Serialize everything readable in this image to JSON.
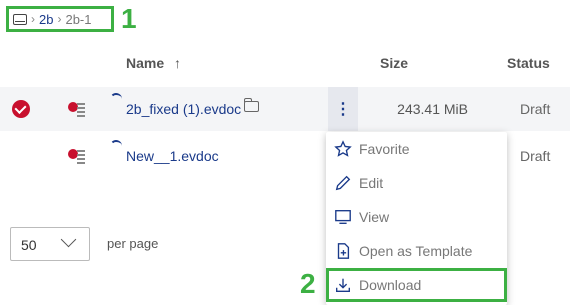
{
  "breadcrumb": {
    "items": [
      "2b",
      "2b-1"
    ]
  },
  "callouts": {
    "one": "1",
    "two": "2"
  },
  "table": {
    "headers": {
      "name": "Name",
      "sort_arrow": "↑",
      "size": "Size",
      "status": "Status"
    },
    "rows": [
      {
        "name": "2b_fixed (1).evdoc",
        "size": "243.41 MiB",
        "status": "Draft",
        "selected": true,
        "actions": "⋮"
      },
      {
        "name": "New__1.evdoc",
        "size": "",
        "status": "Draft",
        "selected": false
      }
    ]
  },
  "pagination": {
    "per_page_value": "50",
    "per_page_label": "per page"
  },
  "context_menu": {
    "items": [
      "Favorite",
      "Edit",
      "View",
      "Open as Template",
      "Download"
    ]
  },
  "colors": {
    "accent": "#1a3a8a",
    "highlight": "#3cb043",
    "danger": "#c8102e"
  }
}
